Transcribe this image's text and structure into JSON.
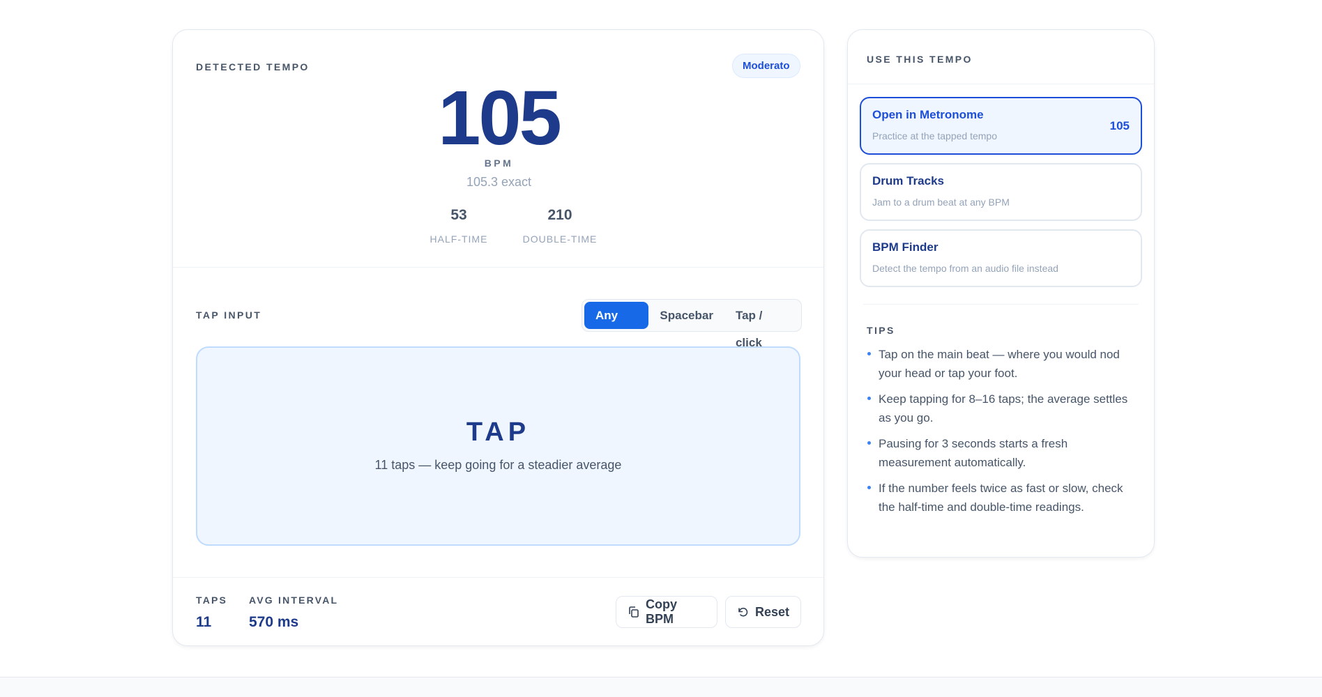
{
  "tempo": {
    "section_label": "DETECTED TEMPO",
    "badge": "Moderato",
    "bpm": "105",
    "unit": "BPM",
    "exact": "105.3 exact",
    "half_time_value": "53",
    "half_time_label": "HALF-TIME",
    "double_time_value": "210",
    "double_time_label": "DOUBLE-TIME"
  },
  "tap_input": {
    "section_label": "TAP INPUT",
    "modes": [
      "Any key",
      "Spacebar",
      "Tap / click"
    ],
    "active_mode": "Any key",
    "pad_word": "TAP",
    "pad_hint": "11 taps — keep going for a steadier average"
  },
  "stats": {
    "taps_label": "TAPS",
    "taps_value": "11",
    "avg_label": "AVG INTERVAL",
    "avg_value": "570 ms"
  },
  "actions": {
    "copy_label": "Copy BPM",
    "reset_label": "Reset"
  },
  "use_tempo": {
    "section_label": "USE THIS TEMPO",
    "links": [
      {
        "title": "Open in Metronome",
        "subtitle": "Practice at the tapped tempo",
        "badge": "105"
      },
      {
        "title": "Drum Tracks",
        "subtitle": "Jam to a drum beat at any BPM"
      },
      {
        "title": "BPM Finder",
        "subtitle": "Detect the tempo from an audio file instead"
      }
    ]
  },
  "tips": {
    "section_label": "TIPS",
    "items": [
      "Tap on the main beat — where you would nod your head or tap your foot.",
      "Keep tapping for 8–16 taps; the average settles as you go.",
      "Pausing for 3 seconds starts a fresh measurement automatically.",
      "If the number feels twice as fast or slow, check the half-time and double-time readings."
    ]
  },
  "colors": {
    "accent": "#1769e8",
    "tempo_navy": "#1e3a8a",
    "pad_background": "#eff6ff",
    "tip_bullet": "#3b82f6"
  },
  "icons": {
    "copy": "copy-icon",
    "reset": "reset-icon"
  }
}
